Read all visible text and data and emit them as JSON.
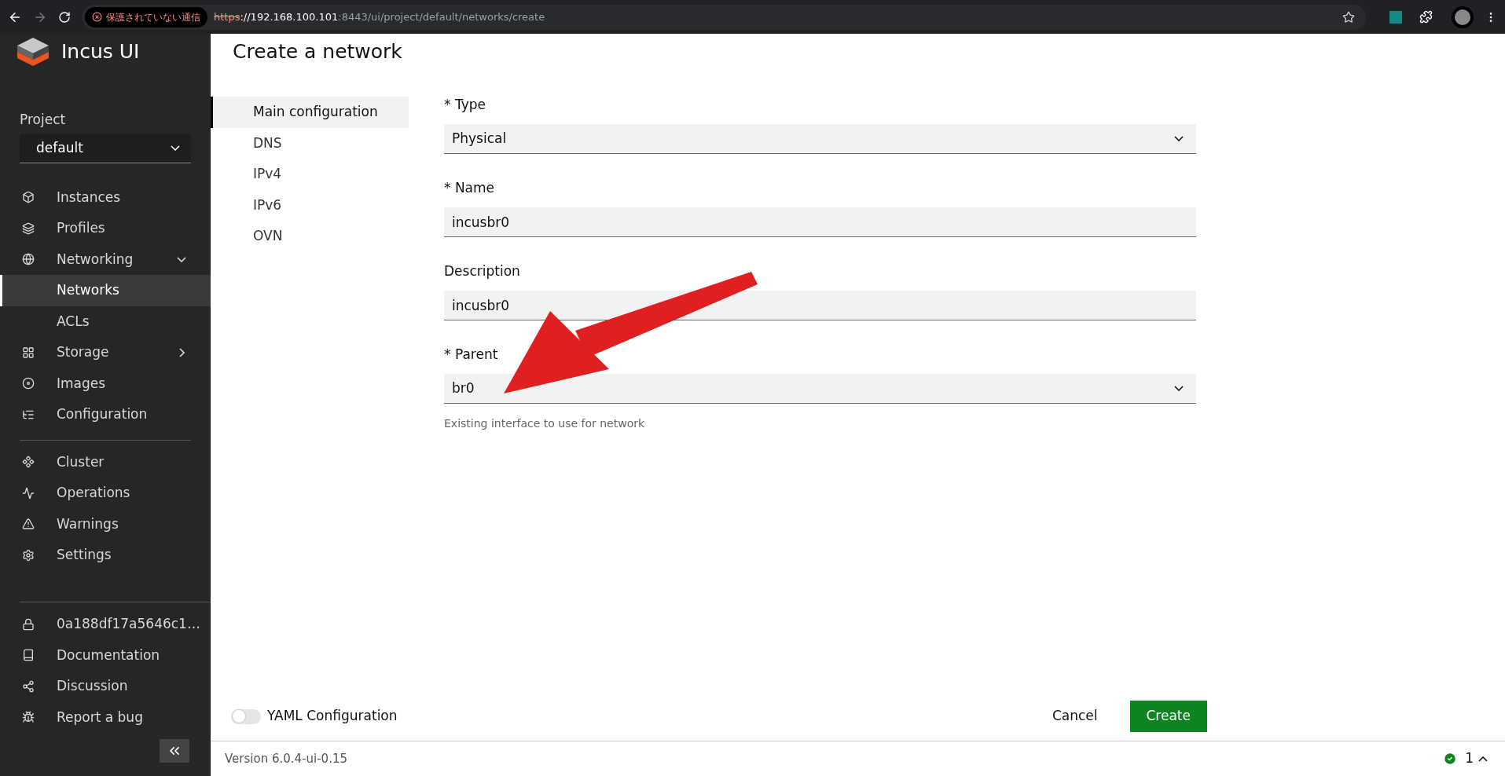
{
  "browser": {
    "security_label": "保護されていない通信",
    "url_scheme": "https",
    "url_host": "://192.168.100.101",
    "url_rest": ":8443/ui/project/default/networks/create"
  },
  "sidebar": {
    "logo_text": "Incus UI",
    "project_label": "Project",
    "project_value": "default",
    "nav": [
      {
        "label": "Instances",
        "selected": false
      },
      {
        "label": "Profiles",
        "selected": false
      },
      {
        "label": "Networking",
        "selected": false,
        "expanded": true,
        "children": [
          {
            "label": "Networks",
            "selected": true
          },
          {
            "label": "ACLs",
            "selected": false
          }
        ]
      },
      {
        "label": "Storage",
        "selected": false,
        "expanded": false
      },
      {
        "label": "Images",
        "selected": false
      },
      {
        "label": "Configuration",
        "selected": false
      }
    ],
    "nav_2": [
      {
        "label": "Cluster",
        "selected": false
      },
      {
        "label": "Operations",
        "selected": false
      },
      {
        "label": "Warnings",
        "selected": false
      },
      {
        "label": "Settings",
        "selected": false
      }
    ],
    "bottom": [
      {
        "label": "0a188df17a5646c1…"
      },
      {
        "label": "Documentation"
      },
      {
        "label": "Discussion"
      },
      {
        "label": "Report a bug"
      }
    ]
  },
  "page": {
    "title": "Create a network",
    "sections": [
      {
        "label": "Main configuration",
        "selected": true
      },
      {
        "label": "DNS",
        "selected": false
      },
      {
        "label": "IPv4",
        "selected": false
      },
      {
        "label": "IPv6",
        "selected": false
      },
      {
        "label": "OVN",
        "selected": false
      }
    ],
    "fields": [
      {
        "kind": "select",
        "label": "* Type",
        "value": "Physical"
      },
      {
        "kind": "text",
        "label": "* Name",
        "value": "incusbr0"
      },
      {
        "kind": "text",
        "label": "Description",
        "value": "incusbr0"
      },
      {
        "kind": "select",
        "label": "* Parent",
        "value": "br0",
        "help": "Existing interface to use for network"
      }
    ],
    "yaml_toggle": {
      "label": "YAML Configuration",
      "on": false
    },
    "buttons": [
      {
        "kind": "plain",
        "label": "Cancel"
      },
      {
        "kind": "primary",
        "label": "Create"
      }
    ]
  },
  "footer": {
    "version": "Version 6.0.4-ui-0.15",
    "status_count": "1"
  }
}
